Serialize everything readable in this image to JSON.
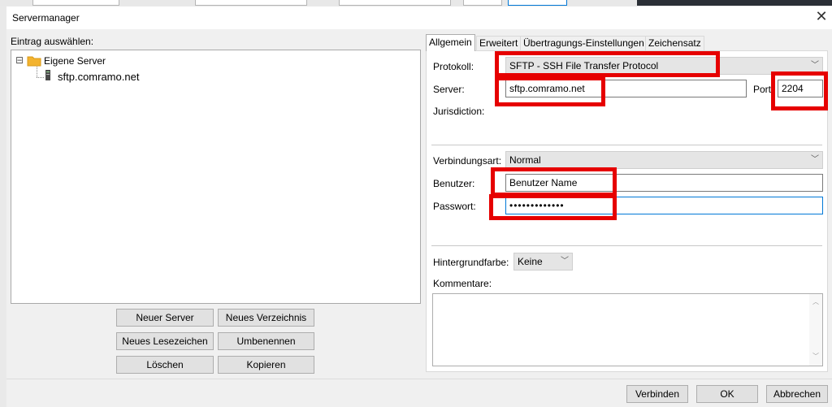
{
  "window": {
    "title": "Servermanager"
  },
  "left": {
    "entry_label": "Eintrag auswählen:",
    "tree": [
      {
        "label": "Eigene Server",
        "expander": "⊟"
      },
      {
        "label": "sftp.comramo.net"
      }
    ],
    "buttons": {
      "new_server": "Neuer Server",
      "new_folder": "Neues Verzeichnis",
      "new_bookmark": "Neues Lesezeichen",
      "rename": "Umbenennen",
      "delete": "Löschen",
      "copy": "Kopieren"
    }
  },
  "tabs": [
    {
      "label": "Allgemein",
      "active": true
    },
    {
      "label": "Erweitert"
    },
    {
      "label": "Übertragungs-Einstellungen"
    },
    {
      "label": "Zeichensatz"
    }
  ],
  "general": {
    "protocol_label": "Protokoll:",
    "protocol_value": "SFTP - SSH File Transfer Protocol",
    "server_label": "Server:",
    "server_value": "sftp.comramo.net",
    "port_label": "Port:",
    "port_value": "2204",
    "jurisdiction_label": "Jurisdiction:",
    "logon_label": "Verbindungsart:",
    "logon_value": "Normal",
    "user_label": "Benutzer:",
    "user_value": "Benutzer Name",
    "password_label": "Passwort:",
    "password_value": "•••••••••••••",
    "bgcolor_label": "Hintergrundfarbe:",
    "bgcolor_value": "Keine",
    "comments_label": "Kommentare:"
  },
  "footer": {
    "connect": "Verbinden",
    "ok": "OK",
    "cancel": "Abbrechen"
  },
  "colors": {
    "highlight": "#e60000",
    "focus": "#0078d7"
  },
  "icons": {
    "close": "close-icon",
    "folder": "folder-icon",
    "server": "server-icon",
    "dropdown": "chevron-down-icon"
  }
}
